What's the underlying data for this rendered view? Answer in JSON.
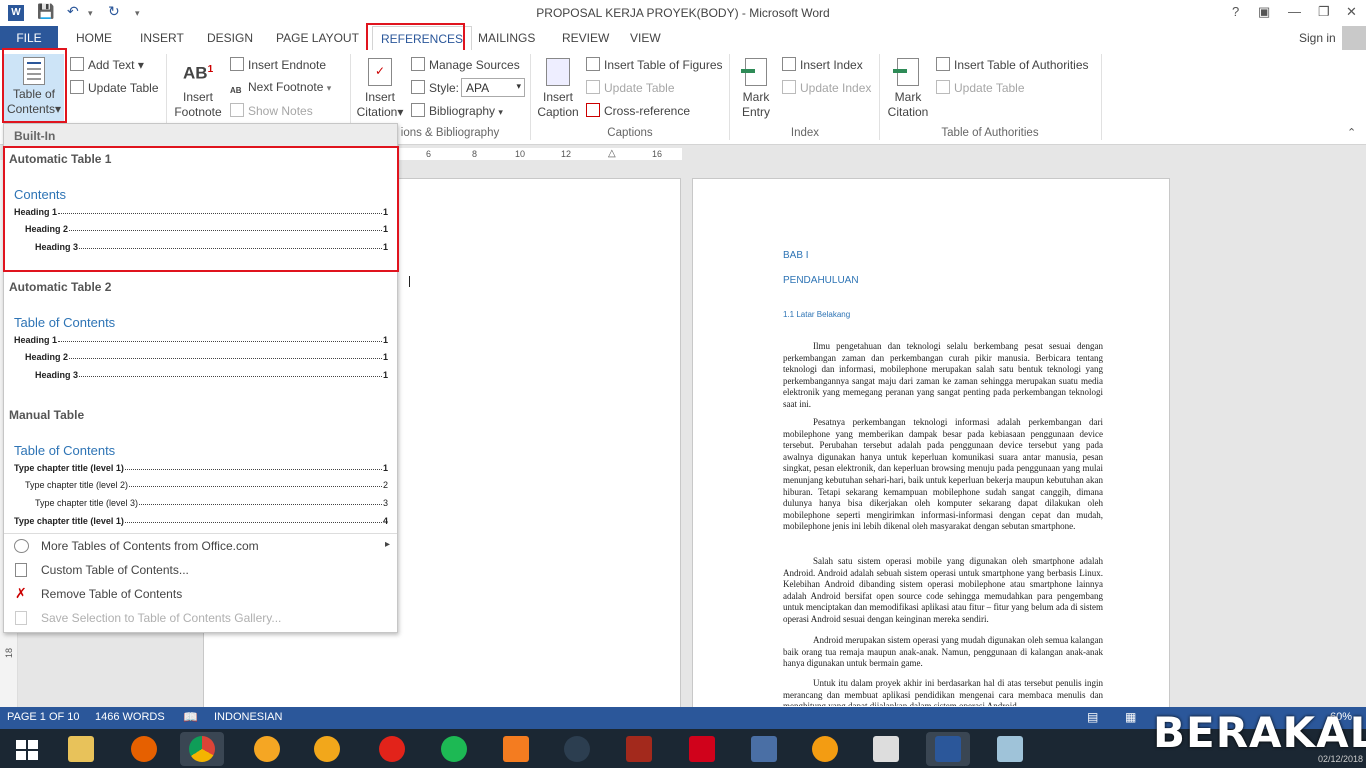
{
  "window": {
    "title": "PROPOSAL KERJA PROYEK(BODY) - Microsoft Word",
    "sign_in": "Sign in",
    "help": "?",
    "restore_ribbon": "▣",
    "minimize": "—",
    "maximize": "❐"
  },
  "tabs": [
    "FILE",
    "HOME",
    "INSERT",
    "DESIGN",
    "PAGE LAYOUT",
    "REFERENCES",
    "MAILINGS",
    "REVIEW",
    "VIEW"
  ],
  "ribbon": {
    "toc": {
      "big_label_1": "Table of",
      "big_label_2": "Contents",
      "add_text": "Add Text",
      "update_table": "Update Table"
    },
    "footnotes": {
      "insert_footnote_1": "Insert",
      "insert_footnote_2": "Footnote",
      "insert_endnote": "Insert Endnote",
      "next_footnote": "Next Footnote",
      "show_notes": "Show Notes"
    },
    "citations": {
      "insert_citation_1": "Insert",
      "insert_citation_2": "Citation",
      "manage_sources": "Manage Sources",
      "style_label": "Style:",
      "style_value": "APA",
      "bibliography": "Bibliography",
      "group_label": "ions & Bibliography"
    },
    "captions": {
      "insert_caption_1": "Insert",
      "insert_caption_2": "Caption",
      "insert_tof": "Insert Table of Figures",
      "update_table": "Update Table",
      "cross_ref": "Cross-reference",
      "group_label": "Captions"
    },
    "index": {
      "mark_entry_1": "Mark",
      "mark_entry_2": "Entry",
      "insert_index": "Insert Index",
      "update_index": "Update Index",
      "group_label": "Index"
    },
    "toa": {
      "mark_citation_1": "Mark",
      "mark_citation_2": "Citation",
      "insert_toa": "Insert Table of Authorities",
      "update_table": "Update Table",
      "group_label": "Table of Authorities"
    }
  },
  "ruler": [
    "6",
    "8",
    "10",
    "12",
    "16"
  ],
  "vruler": "18",
  "dropdown": {
    "header": "Built-In",
    "sections": [
      {
        "title": "Automatic Table 1",
        "heading": "Contents",
        "rows": [
          {
            "text": "Heading 1",
            "page": "1"
          },
          {
            "text": "Heading 2",
            "page": "1"
          },
          {
            "text": "Heading 3",
            "page": "1"
          }
        ]
      },
      {
        "title": "Automatic Table 2",
        "heading": "Table of Contents",
        "rows": [
          {
            "text": "Heading 1",
            "page": "1"
          },
          {
            "text": "Heading 2",
            "page": "1"
          },
          {
            "text": "Heading 3",
            "page": "1"
          }
        ]
      },
      {
        "title": "Manual Table",
        "heading": "Table of Contents",
        "rows": [
          {
            "text": "Type chapter title (level 1)",
            "page": "1"
          },
          {
            "text": "Type chapter title (level 2)",
            "page": "2"
          },
          {
            "text": "Type chapter title (level 3)",
            "page": "3"
          },
          {
            "text": "Type chapter title (level 1)",
            "page": "4"
          }
        ]
      }
    ],
    "items": [
      "More Tables of Contents from Office.com",
      "Custom Table of Contents...",
      "Remove Table of Contents",
      "Save Selection to Table of Contents Gallery..."
    ]
  },
  "document": {
    "bab": "BAB I",
    "chapter_title": "PENDAHULUAN",
    "section": "1.1 Latar Belakang",
    "p1": "Ilmu pengetahuan dan teknologi selalu berkembang pesat sesuai dengan perkembangan zaman dan perkembangan curah pikir manusia. Berbicara tentang teknologi dan informasi, mobilephone merupakan salah satu bentuk teknologi yang perkembangannya sangat maju dari zaman ke zaman sehingga merupakan suatu media elektronik yang memegang peranan yang sangat penting pada perkembangan teknologi saat ini.",
    "p2": "Pesatnya perkembangan teknologi informasi adalah perkembangan dari mobilephone yang memberikan dampak besar pada kebiasaan penggunaan device tersebut. Perubahan tersebut adalah pada penggunaan device tersebut yang pada awalnya digunakan hanya untuk keperluan komunikasi suara antar manusia, pesan singkat, pesan elektronik, dan keperluan browsing menuju pada penggunaan yang mulai menunjang kebutuhan sehari-hari, baik untuk keperluan bekerja maupun kebutuhan akan hiburan. Tetapi sekarang kemampuan mobilephone sudah sangat canggih, dimana dulunya hanya bisa dikerjakan oleh komputer sekarang dapat dilakukan oleh mobilephone seperti mengirimkan informasi-informasi dengan cepat dan mudah, mobilephone jenis ini lebih dikenal oleh masyarakat dengan sebutan smartphone.",
    "p3": "Salah satu sistem operasi mobile yang digunakan oleh smartphone adalah Android. Android adalah sebuah sistem operasi untuk smartphone yang berbasis Linux. Kelebihan Android dibanding sistem operasi mobilephone atau smartphone lainnya adalah Android bersifat open source code sehingga memudahkan para pengembang untuk menciptakan dan memodifikasi aplikasi atau fitur – fitur yang belum ada di sistem operasi Android sesuai dengan keinginan mereka sendiri.",
    "p4": "Android merupakan sistem operasi yang mudah digunakan oleh semua kalangan baik orang tua remaja maupun anak-anak. Namun, penggunaan di kalangan anak-anak hanya digunakan untuk bermain game.",
    "p5": "Untuk itu dalam proyek akhir ini berdasarkan hal di atas tersebut penulis ingin merancang dan membuat aplikasi pendidikan mengenai cara membaca menulis dan menghitung yang dapat dijalankan dalam sistem operasi Android."
  },
  "status": {
    "page": "PAGE 1 OF 10",
    "words": "1466 WORDS",
    "language": "INDONESIAN",
    "zoom": "60%"
  },
  "watermark": {
    "text": "BERAKAL",
    "date": "02/12/2018"
  },
  "colors": {
    "accent": "#2b579a",
    "highlight": "#e0141e",
    "heading_blue": "#2e74b5"
  }
}
